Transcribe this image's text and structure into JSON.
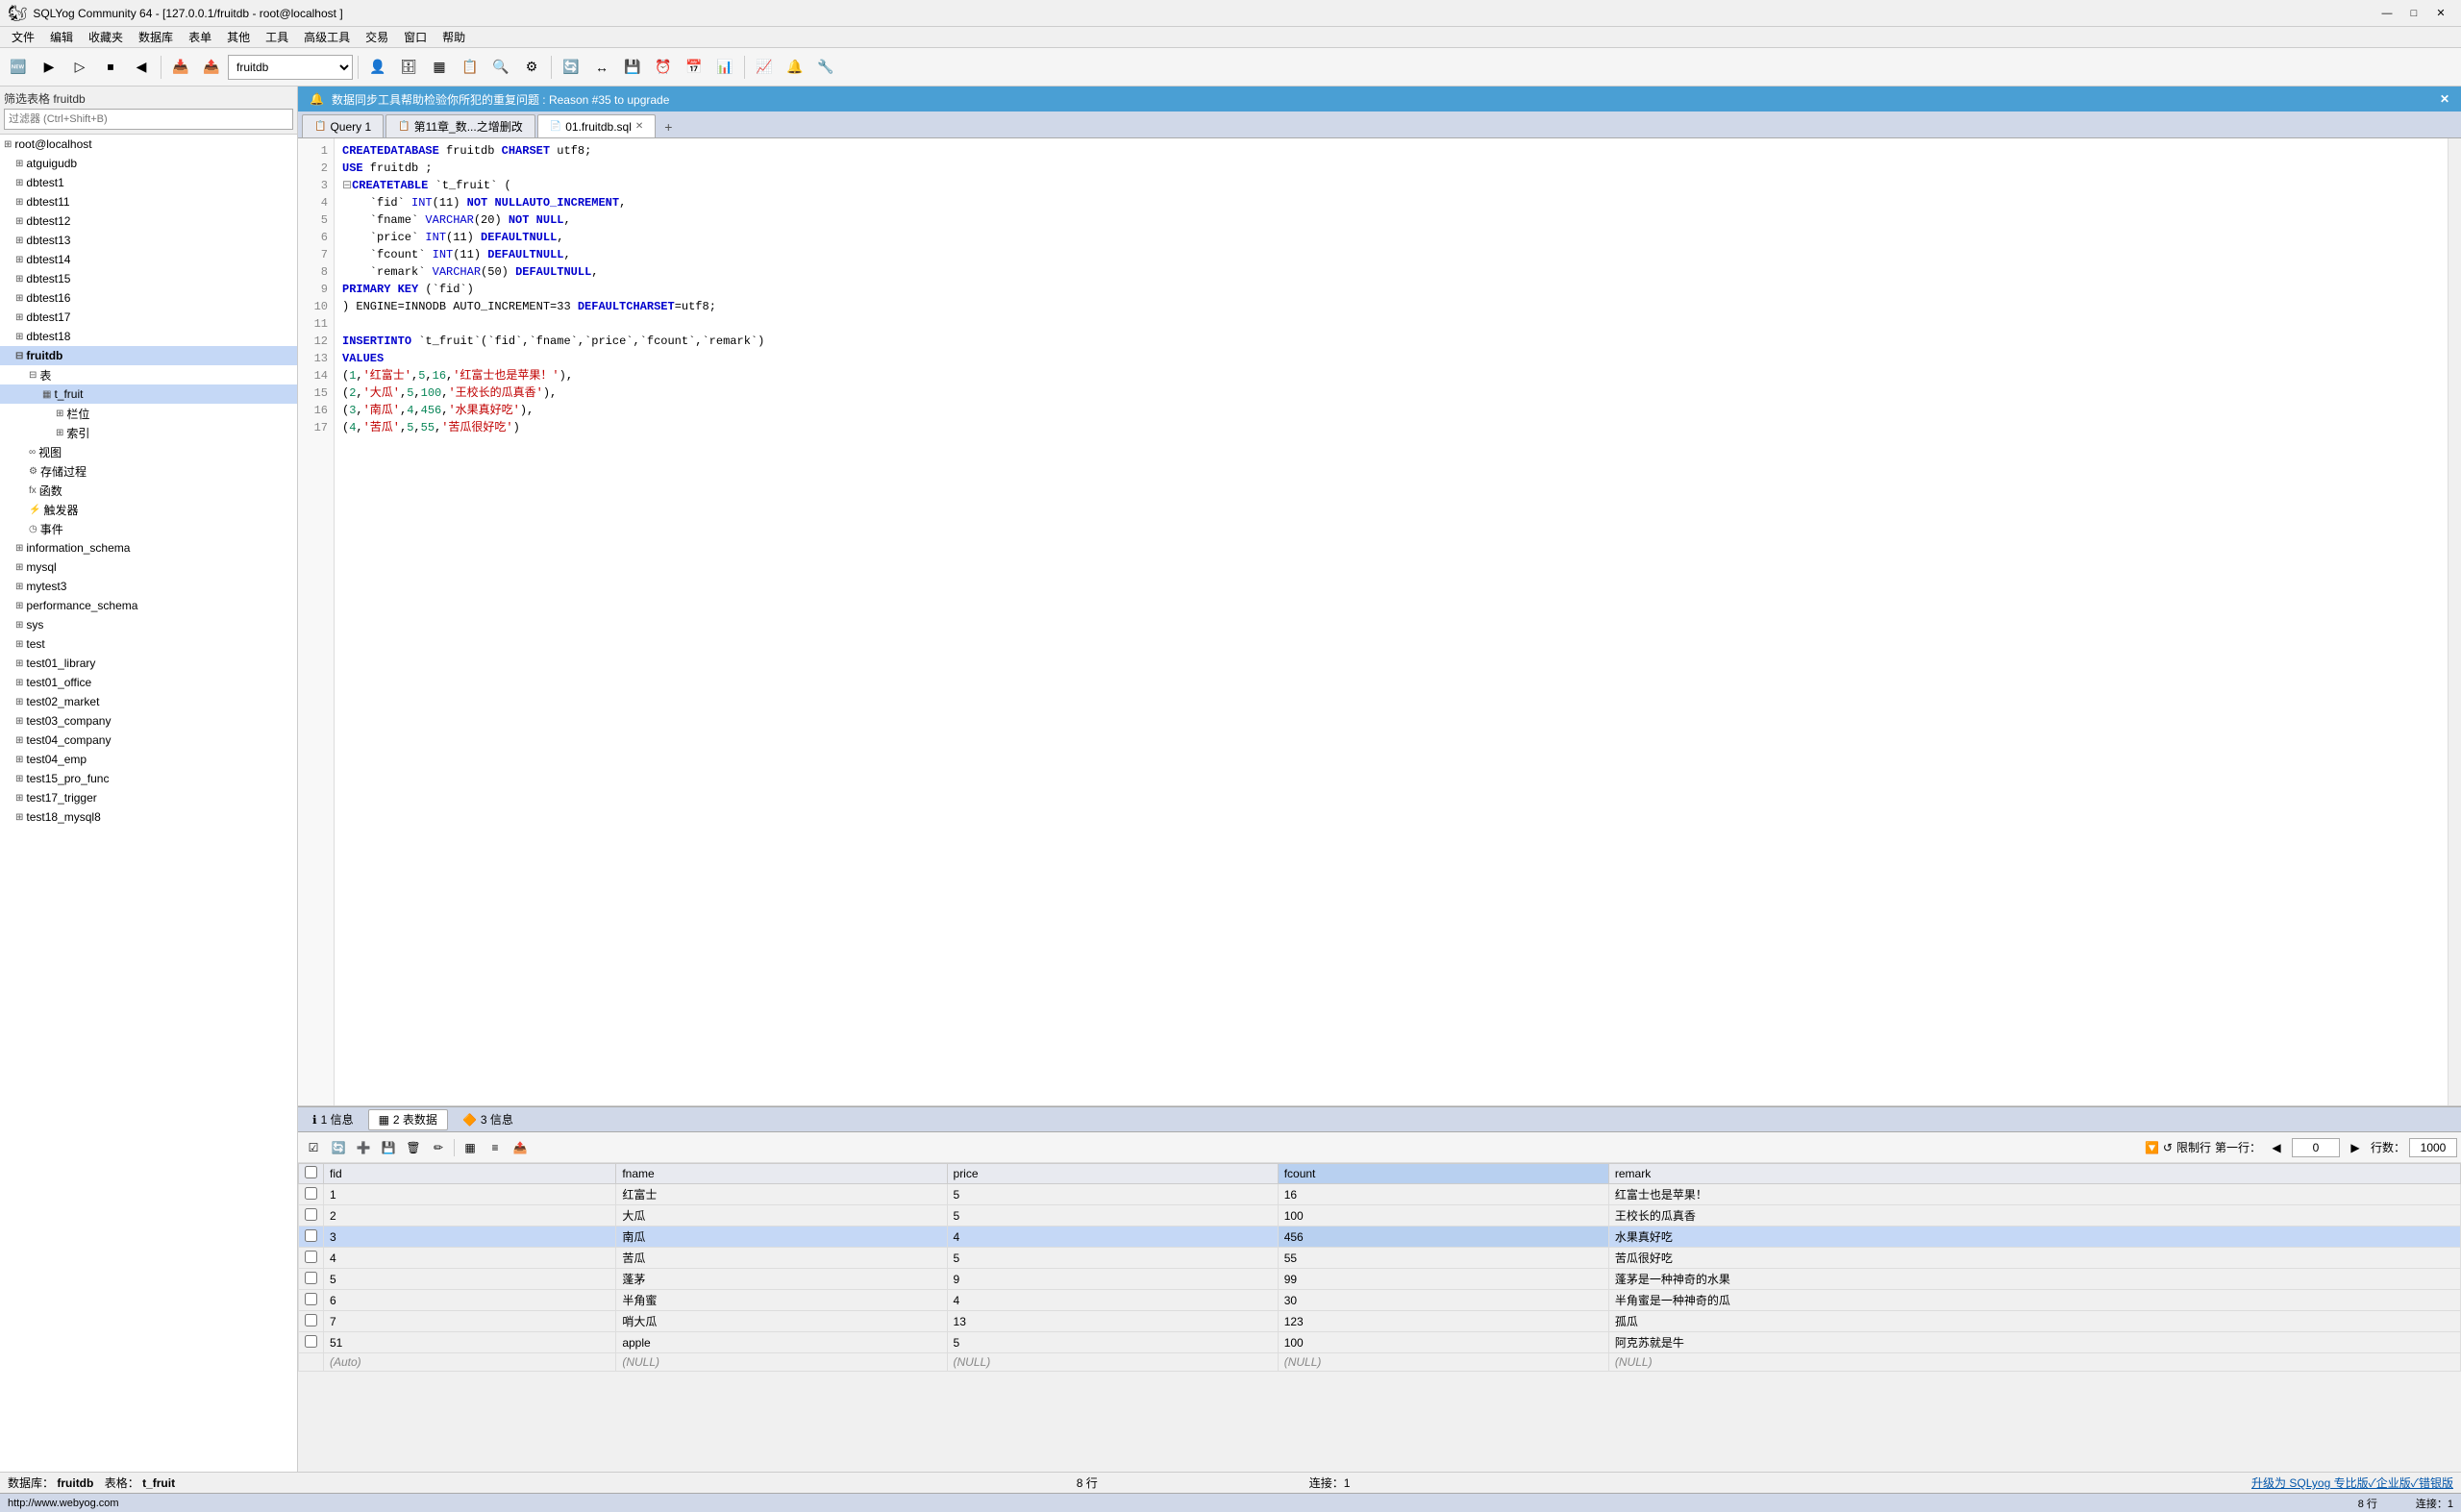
{
  "titlebar": {
    "title": "SQLYog Community 64 - [127.0.0.1/fruitdb - root@localhost ]",
    "minimize": "—",
    "maximize": "□",
    "close": "✕"
  },
  "menubar": {
    "items": [
      "文件",
      "编辑",
      "收藏夹",
      "数据库",
      "表单",
      "其他",
      "工具",
      "高级工具",
      "交易",
      "窗口",
      "帮助"
    ]
  },
  "toolbar": {
    "dropdown_value": "fruitdb"
  },
  "left_panel": {
    "filter_label": "筛选表格 fruitdb",
    "filter_placeholder": "过滤器 (Ctrl+Shift+B)",
    "tree": [
      {
        "label": "root@localhost",
        "indent": 0,
        "icon": "⊞",
        "type": "server"
      },
      {
        "label": "atguigudb",
        "indent": 1,
        "icon": "⊞",
        "type": "db"
      },
      {
        "label": "dbtest1",
        "indent": 1,
        "icon": "⊞",
        "type": "db"
      },
      {
        "label": "dbtest11",
        "indent": 1,
        "icon": "⊞",
        "type": "db"
      },
      {
        "label": "dbtest12",
        "indent": 1,
        "icon": "⊞",
        "type": "db"
      },
      {
        "label": "dbtest13",
        "indent": 1,
        "icon": "⊞",
        "type": "db"
      },
      {
        "label": "dbtest14",
        "indent": 1,
        "icon": "⊞",
        "type": "db"
      },
      {
        "label": "dbtest15",
        "indent": 1,
        "icon": "⊞",
        "type": "db"
      },
      {
        "label": "dbtest16",
        "indent": 1,
        "icon": "⊞",
        "type": "db"
      },
      {
        "label": "dbtest17",
        "indent": 1,
        "icon": "⊞",
        "type": "db"
      },
      {
        "label": "dbtest18",
        "indent": 1,
        "icon": "⊞",
        "type": "db"
      },
      {
        "label": "fruitdb",
        "indent": 1,
        "icon": "⊟",
        "type": "db",
        "selected": true,
        "bold": true
      },
      {
        "label": "表",
        "indent": 2,
        "icon": "⊟",
        "type": "folder"
      },
      {
        "label": "t_fruit",
        "indent": 3,
        "icon": "▦",
        "type": "table",
        "selected": true
      },
      {
        "label": "栏位",
        "indent": 4,
        "icon": "⊞",
        "type": "folder"
      },
      {
        "label": "索引",
        "indent": 4,
        "icon": "⊞",
        "type": "folder"
      },
      {
        "label": "视图",
        "indent": 2,
        "icon": "∞",
        "type": "folder"
      },
      {
        "label": "存储过程",
        "indent": 2,
        "icon": "⚙",
        "type": "folder"
      },
      {
        "label": "函数",
        "indent": 2,
        "icon": "fx",
        "type": "folder"
      },
      {
        "label": "触发器",
        "indent": 2,
        "icon": "⚡",
        "type": "folder"
      },
      {
        "label": "事件",
        "indent": 2,
        "icon": "◷",
        "type": "folder"
      },
      {
        "label": "information_schema",
        "indent": 1,
        "icon": "⊞",
        "type": "db"
      },
      {
        "label": "mysql",
        "indent": 1,
        "icon": "⊞",
        "type": "db"
      },
      {
        "label": "mytest3",
        "indent": 1,
        "icon": "⊞",
        "type": "db"
      },
      {
        "label": "performance_schema",
        "indent": 1,
        "icon": "⊞",
        "type": "db"
      },
      {
        "label": "sys",
        "indent": 1,
        "icon": "⊞",
        "type": "db"
      },
      {
        "label": "test",
        "indent": 1,
        "icon": "⊞",
        "type": "db"
      },
      {
        "label": "test01_library",
        "indent": 1,
        "icon": "⊞",
        "type": "db"
      },
      {
        "label": "test01_office",
        "indent": 1,
        "icon": "⊞",
        "type": "db"
      },
      {
        "label": "test02_market",
        "indent": 1,
        "icon": "⊞",
        "type": "db"
      },
      {
        "label": "test03_company",
        "indent": 1,
        "icon": "⊞",
        "type": "db"
      },
      {
        "label": "test04_company",
        "indent": 1,
        "icon": "⊞",
        "type": "db"
      },
      {
        "label": "test04_emp",
        "indent": 1,
        "icon": "⊞",
        "type": "db"
      },
      {
        "label": "test15_pro_func",
        "indent": 1,
        "icon": "⊞",
        "type": "db"
      },
      {
        "label": "test17_trigger",
        "indent": 1,
        "icon": "⊞",
        "type": "db"
      },
      {
        "label": "test18_mysql8",
        "indent": 1,
        "icon": "⊞",
        "type": "db"
      }
    ]
  },
  "notice": {
    "text": "数据同步工具帮助检验你所犯的重复问题 : Reason #35 to upgrade",
    "close": "✕"
  },
  "tabs": [
    {
      "label": "Query 1",
      "icon": "📋",
      "active": false,
      "closable": false
    },
    {
      "label": "第11章_数...之增删改",
      "icon": "📋",
      "active": false,
      "closable": false
    },
    {
      "label": "01.fruitdb.sql",
      "icon": "📄",
      "active": true,
      "closable": true
    }
  ],
  "editor": {
    "lines": [
      {
        "n": 1,
        "code": "CREATE DATABASE fruitdb CHARSET utf8;",
        "tokens": [
          {
            "t": "kw",
            "v": "CREATE"
          },
          {
            "t": "punc",
            "v": " "
          },
          {
            "t": "kw",
            "v": "DATABASE"
          },
          {
            "t": "punc",
            "v": " fruitdb "
          },
          {
            "t": "kw",
            "v": "CHARSET"
          },
          {
            "t": "punc",
            "v": " utf8;"
          }
        ]
      },
      {
        "n": 2,
        "code": "USE fruitdb ;",
        "tokens": [
          {
            "t": "kw",
            "v": "USE"
          },
          {
            "t": "punc",
            "v": " fruitdb ;"
          }
        ]
      },
      {
        "n": 3,
        "code": "CREATE TABLE `t_fruit` (",
        "tokens": [
          {
            "t": "fold",
            "v": "⊟"
          },
          {
            "t": "kw",
            "v": "CREATE"
          },
          {
            "t": "punc",
            "v": " "
          },
          {
            "t": "kw",
            "v": "TABLE"
          },
          {
            "t": "punc",
            "v": " `t_fruit` ("
          }
        ]
      },
      {
        "n": 4,
        "code": "  `fid` INT(11) NOT NULL AUTO_INCREMENT,"
      },
      {
        "n": 5,
        "code": "  `fname` VARCHAR(20) NOT NULL,"
      },
      {
        "n": 6,
        "code": "  `price` INT(11) DEFAULT NULL,"
      },
      {
        "n": 7,
        "code": "  `fcount` INT(11) DEFAULT NULL,"
      },
      {
        "n": 8,
        "code": "  `remark` VARCHAR(50) DEFAULT NULL,"
      },
      {
        "n": 9,
        "code": "  PRIMARY KEY (`fid`)"
      },
      {
        "n": 10,
        "code": ") ENGINE=INNODB AUTO_INCREMENT=33 DEFAULT CHARSET=utf8;"
      },
      {
        "n": 11,
        "code": ""
      },
      {
        "n": 12,
        "code": "INSERT  INTO `t_fruit`(`fid`,`fname`,`price`,`fcount`,`remark`)"
      },
      {
        "n": 13,
        "code": "VALUES"
      },
      {
        "n": 14,
        "code": "(1,'红富士',5,16,'红富士也是苹果！'),"
      },
      {
        "n": 15,
        "code": "(2,'大瓜',5,100,'王校长的瓜真香'),"
      },
      {
        "n": 16,
        "code": "(3,'南瓜',4,456,'水果真好吃'),"
      },
      {
        "n": 17,
        "code": "(4,'苦瓜',5,55,'苦瓜很好吃')"
      }
    ]
  },
  "bottom_tabs": [
    {
      "id": "info",
      "label": "1 信息",
      "icon": "ℹ"
    },
    {
      "id": "data",
      "label": "2 表数据",
      "icon": "▦",
      "active": true
    },
    {
      "id": "msg",
      "label": "3 信息",
      "icon": "🔶"
    }
  ],
  "grid": {
    "columns": [
      "fid",
      "fname",
      "price",
      "fcount",
      "remark"
    ],
    "rows": [
      {
        "fid": "1",
        "fname": "红富士",
        "price": "5",
        "fcount": "16",
        "remark": "红富士也是苹果！"
      },
      {
        "fid": "2",
        "fname": "大瓜",
        "price": "5",
        "fcount": "100",
        "remark": "王校长的瓜真香"
      },
      {
        "fid": "3",
        "fname": "南瓜",
        "price": "4",
        "fcount": "456",
        "remark": "水果真好吃",
        "selected": true
      },
      {
        "fid": "4",
        "fname": "苦瓜",
        "price": "5",
        "fcount": "55",
        "remark": "苦瓜很好吃"
      },
      {
        "fid": "5",
        "fname": "蓬茅",
        "price": "9",
        "fcount": "99",
        "remark": "蓬茅是一种神奇的水果"
      },
      {
        "fid": "6",
        "fname": "半角蜜",
        "price": "4",
        "fcount": "30",
        "remark": "半角蜜是一种神奇的瓜"
      },
      {
        "fid": "7",
        "fname": "哨大瓜",
        "price": "13",
        "fcount": "123",
        "remark": "孤瓜"
      },
      {
        "fid": "51",
        "fname": "apple",
        "price": "5",
        "fcount": "100",
        "remark": "阿克苏就是牛"
      },
      {
        "fid": "(Auto)",
        "fname": "(NULL)",
        "price": "(NULL)",
        "fcount": "(NULL)",
        "remark": "(NULL)",
        "is_new": true
      }
    ],
    "limit_label": "□限制行",
    "first_label": "第一行：",
    "first_val": "0",
    "rows_label": "行数：",
    "rows_val": "1000"
  },
  "statusbar": {
    "db_label": "数据库：",
    "db_val": "fruitdb",
    "table_label": "表格：",
    "table_val": "t_fruit",
    "rows_info": "8 行",
    "conn_info": "连接：1",
    "upgrade_link": "升级为 SQLyog 专比版✓企业版✓错银版"
  },
  "footer": {
    "website": "http://www.webyog.com"
  }
}
